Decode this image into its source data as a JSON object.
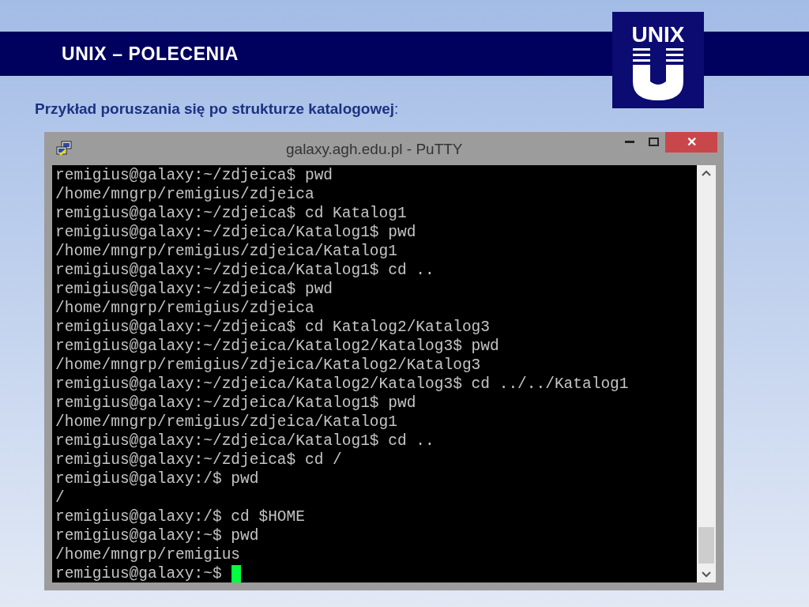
{
  "header": {
    "title": "UNIX – POLECENIA",
    "logo_text": "UNIX"
  },
  "subtitle": "**Przykład poruszania się po strukturze katalogowej**:",
  "window": {
    "title": "galaxy.agh.edu.pl - PuTTY",
    "close": "✕"
  },
  "terminal": {
    "cursor_visible": true,
    "lines": [
      "remigius@galaxy:~/zdjeica$ pwd",
      "/home/mngrp/remigius/zdjeica",
      "remigius@galaxy:~/zdjeica$ cd Katalog1",
      "remigius@galaxy:~/zdjeica/Katalog1$ pwd",
      "/home/mngrp/remigius/zdjeica/Katalog1",
      "remigius@galaxy:~/zdjeica/Katalog1$ cd ..",
      "remigius@galaxy:~/zdjeica$ pwd",
      "/home/mngrp/remigius/zdjeica",
      "remigius@galaxy:~/zdjeica$ cd Katalog2/Katalog3",
      "remigius@galaxy:~/zdjeica/Katalog2/Katalog3$ pwd",
      "/home/mngrp/remigius/zdjeica/Katalog2/Katalog3",
      "remigius@galaxy:~/zdjeica/Katalog2/Katalog3$ cd ../../Katalog1",
      "remigius@galaxy:~/zdjeica/Katalog1$ pwd",
      "/home/mngrp/remigius/zdjeica/Katalog1",
      "remigius@galaxy:~/zdjeica/Katalog1$ cd ..",
      "remigius@galaxy:~/zdjeica$ cd /",
      "remigius@galaxy:/$ pwd",
      "/",
      "remigius@galaxy:/$ cd $HOME",
      "remigius@galaxy:~$ pwd",
      "/home/mngrp/remigius",
      "remigius@galaxy:~$"
    ]
  }
}
